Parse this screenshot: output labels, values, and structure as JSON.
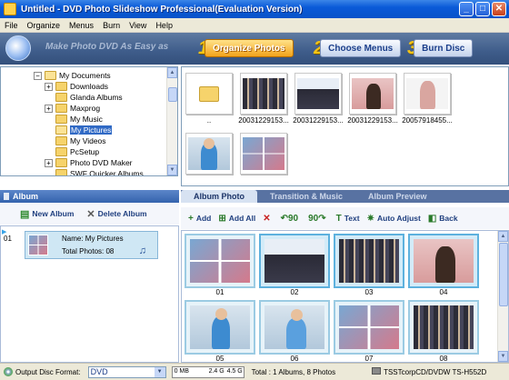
{
  "window": {
    "title": "Untitled - DVD Photo Slideshow Professional(Evaluation Version)"
  },
  "menu": [
    "File",
    "Organize",
    "Menus",
    "Burn",
    "View",
    "Help"
  ],
  "banner": {
    "slogan": "Make Photo DVD As Easy as",
    "steps": [
      {
        "num": "1",
        "label": "Organize Photos",
        "active": true
      },
      {
        "num": "2",
        "label": "Choose Menus",
        "active": false
      },
      {
        "num": "3",
        "label": "Burn Disc",
        "active": false
      }
    ]
  },
  "tree": [
    {
      "label": "My Documents",
      "exp": "−",
      "open": true
    },
    {
      "label": "Downloads",
      "exp": "+"
    },
    {
      "label": "Glanda Albums",
      "exp": ""
    },
    {
      "label": "Maxprog",
      "exp": "+"
    },
    {
      "label": "My Music",
      "exp": ""
    },
    {
      "label": "My Pictures",
      "exp": "",
      "selected": true
    },
    {
      "label": "My Videos",
      "exp": ""
    },
    {
      "label": "PcSetup",
      "exp": ""
    },
    {
      "label": "Photo DVD Maker",
      "exp": "+"
    },
    {
      "label": "SWF Quicker Albums",
      "exp": ""
    }
  ],
  "files": [
    {
      "caption": "..",
      "kind": "folder"
    },
    {
      "caption": "20031229153...",
      "kind": "band"
    },
    {
      "caption": "20031229153...",
      "kind": "group"
    },
    {
      "caption": "20031229153...",
      "kind": "pink"
    },
    {
      "caption": "20057918455...",
      "kind": "pink2"
    },
    {
      "caption": "",
      "kind": "boy"
    },
    {
      "caption": "",
      "kind": "grid"
    }
  ],
  "album": {
    "heading": "Album",
    "new_label": "New Album",
    "delete_label": "Delete Album",
    "index": "01",
    "name": "Name: My Pictures",
    "total": "Total Photos: 08"
  },
  "tabs": [
    {
      "label": "Album Photo",
      "active": true
    },
    {
      "label": "Transition & Music",
      "active": false
    },
    {
      "label": "Album Preview",
      "active": false
    }
  ],
  "photo_tools": [
    {
      "label": "Add",
      "icon": "+"
    },
    {
      "label": "Add All",
      "icon": "⊞"
    },
    {
      "label": "",
      "icon": "✕",
      "red": true
    },
    {
      "label": "",
      "icon": "↶90"
    },
    {
      "label": "",
      "icon": "90↷"
    },
    {
      "label": "Text",
      "icon": "T"
    },
    {
      "label": "Auto Adjust",
      "icon": "✷"
    },
    {
      "label": "Back",
      "icon": "◧"
    }
  ],
  "album_photos": [
    {
      "caption": "01",
      "kind": "grid",
      "selected": false
    },
    {
      "caption": "02",
      "kind": "group",
      "selected": true
    },
    {
      "caption": "03",
      "kind": "band",
      "selected": true
    },
    {
      "caption": "04",
      "kind": "pink",
      "selected": true
    },
    {
      "caption": "05",
      "kind": "boy",
      "selected": false
    },
    {
      "caption": "06",
      "kind": "boy2",
      "selected": false
    },
    {
      "caption": "07",
      "kind": "grid",
      "selected": false
    },
    {
      "caption": "08",
      "kind": "band",
      "selected": false
    }
  ],
  "status": {
    "output_label": "Output Disc Format:",
    "format": "DVD",
    "ruler": [
      "0 MB",
      "2.4 G",
      "4.5 G"
    ],
    "total": "Total : 1 Albums, 8 Photos",
    "drive": "TSSTcorpCD/DVDW TS-H552D"
  }
}
